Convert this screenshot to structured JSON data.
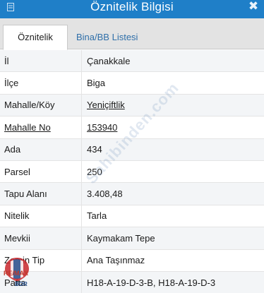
{
  "window": {
    "title": "Öznitelik Bilgisi",
    "close_icon": "close-x-icon"
  },
  "tabs": [
    {
      "label": "Öznitelik Bilgisi",
      "active": true
    },
    {
      "label": "Bina/BB Listesi",
      "active": false
    }
  ],
  "attributes": [
    {
      "key": "İl",
      "value": "Çanakkale"
    },
    {
      "key": "İlçe",
      "value": "Biga"
    },
    {
      "key": "Mahalle/Köy",
      "value": "Yeniçiftlik"
    },
    {
      "key": "Mahalle No",
      "value": "153940"
    },
    {
      "key": "Ada",
      "value": "434"
    },
    {
      "key": "Parsel",
      "value": "250"
    },
    {
      "key": "Tapu Alanı",
      "value": "3.408,48"
    },
    {
      "key": "Nitelik",
      "value": "Tarla"
    },
    {
      "key": "Mevkii",
      "value": "Kaymakam Tepe"
    },
    {
      "key": "Zemin Tip",
      "value": "Ana Taşınmaz"
    },
    {
      "key": "Pafta",
      "value": "H18-A-19-D-3-B, H18-A-19-D-3"
    }
  ],
  "watermark": "Sahibinden.com",
  "logo": {
    "brand": "RE/MAX",
    "sub": "BOR"
  },
  "colors": {
    "title_bar": "#1f7fc8",
    "tab_link": "#2f6fa9",
    "row_alt": "#f3f5f7"
  }
}
